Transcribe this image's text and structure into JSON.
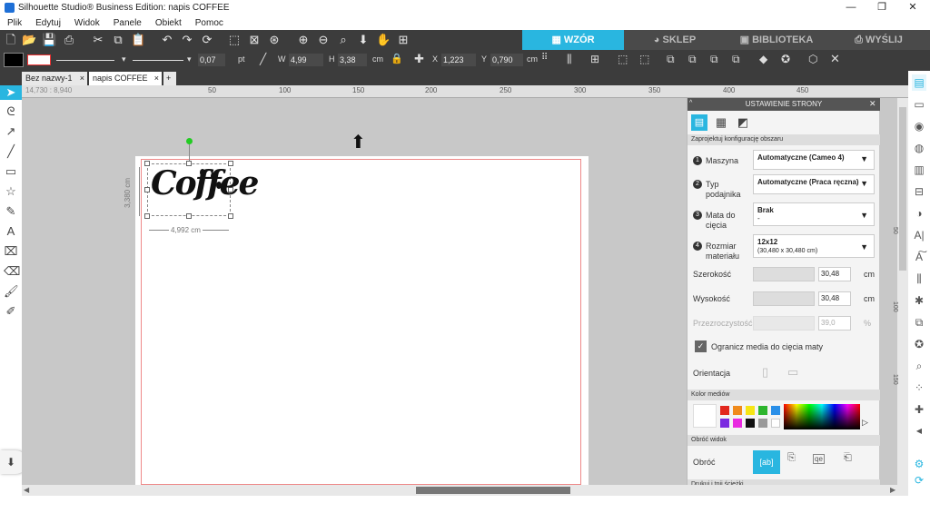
{
  "titlebar": {
    "title": "Silhouette Studio® Business Edition: napis COFFEE",
    "min": "—",
    "max": "❐",
    "close": "✕"
  },
  "menu": [
    "Plik",
    "Edytuj",
    "Widok",
    "Panele",
    "Obiekt",
    "Pomoc"
  ],
  "nav": {
    "wzor": "WZÓR",
    "sklep": "SKLEP",
    "biblioteka": "BIBLIOTEKA",
    "wyslij": "WYŚLIJ"
  },
  "props": {
    "line_width": "0,07",
    "line_unit": "pt",
    "w_label": "W",
    "w_value": "4,99",
    "h_label": "H",
    "h_value": "3,38",
    "size_unit": "cm",
    "x_label": "X",
    "x_value": "1,223",
    "y_label": "Y",
    "y_value": "0,790",
    "pos_unit": "cm"
  },
  "tabs": [
    {
      "label": "Bez nazwy-1"
    },
    {
      "label": "napis COFFEE"
    }
  ],
  "coords": "14,730 : 8,940",
  "ruler": [
    "50",
    "100",
    "150",
    "200",
    "250",
    "300",
    "350",
    "400",
    "450"
  ],
  "canvas": {
    "text": "Coffee",
    "dim_h": "3,380 cm",
    "dim_w": "4,992 cm"
  },
  "vruler": [
    "50",
    "100",
    "150"
  ],
  "panel": {
    "title": "USTAWIENIE STRONY",
    "section1": "Zaprojektuj konfigurację obszaru",
    "machine_label": "Maszyna",
    "machine_value": "Automatyczne (Cameo 4)",
    "feed_label1": "Typ",
    "feed_label2": "podajnika",
    "feed_value": "Automatyczne (Praca ręczna)",
    "mat_label1": "Mata do",
    "mat_label2": "cięcia",
    "mat_value": "Brak",
    "mat_sub": "-",
    "media_label1": "Rozmiar",
    "media_label2": "materiału",
    "media_value": "12x12",
    "media_sub": "(30,480 x 30,480 cm)",
    "width_label": "Szerokość",
    "width_value": "30,48",
    "width_unit": "cm",
    "height_label": "Wysokość",
    "height_value": "30,48",
    "height_unit": "cm",
    "transp_label": "Przezroczystość",
    "transp_value": "39,0",
    "transp_unit": "%",
    "limit_label": "Ogranicz media do cięcia maty",
    "orient_label": "Orientacja",
    "color_section": "Kolor mediów",
    "rotate_section": "Obróć widok",
    "rotate_label": "Obróć",
    "bottom_section": "Drukuj i tnij ścieżki"
  },
  "colors": {
    "accent": "#29b6e0",
    "toolbar": "#3c3c3c",
    "tab_dark": "#4a4a4a"
  }
}
